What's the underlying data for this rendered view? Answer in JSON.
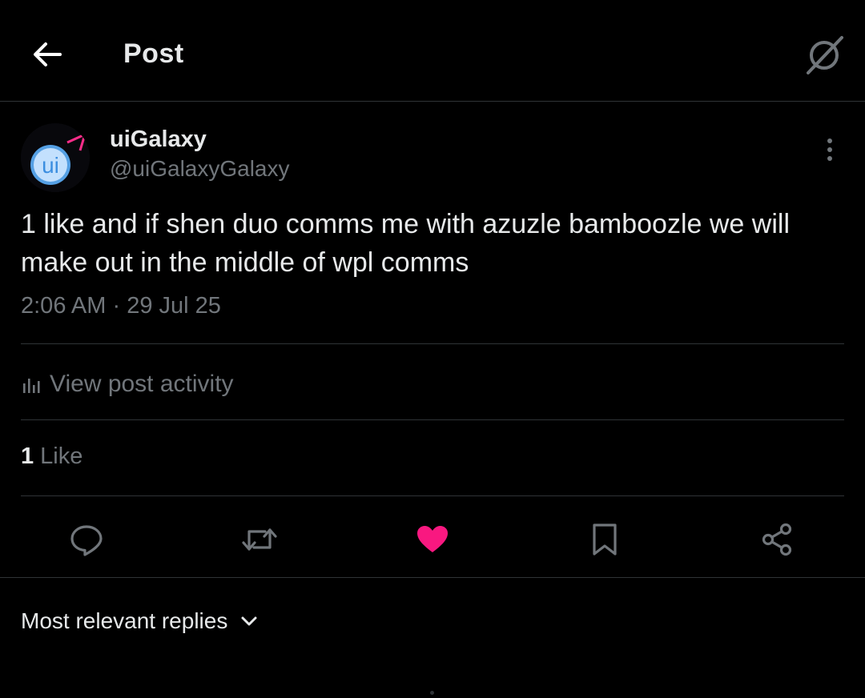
{
  "header": {
    "title": "Post",
    "back_icon": "arrow-left-icon",
    "grok_icon": "grok-icon"
  },
  "author": {
    "name": "uiGalaxy",
    "handle": "@uiGalaxyGalaxy",
    "avatar_text": "ui"
  },
  "post": {
    "text": "1 like and if shen duo comms me with azuzle bamboozle we will make out in the middle of wpl comms",
    "time": "2:06 AM",
    "separator": "·",
    "date": "29 Jul 25"
  },
  "activity": {
    "label": "View post activity",
    "icon": "bar-chart-icon"
  },
  "likes": {
    "count": "1",
    "label": "Like"
  },
  "actions": [
    {
      "name": "reply",
      "icon": "comment-icon"
    },
    {
      "name": "repost",
      "icon": "repost-icon"
    },
    {
      "name": "like",
      "icon": "heart-icon",
      "active": true
    },
    {
      "name": "bookmark",
      "icon": "bookmark-icon"
    },
    {
      "name": "share",
      "icon": "share-icon"
    }
  ],
  "replies": {
    "sort_label": "Most relevant replies"
  },
  "colors": {
    "background": "#000000",
    "text_primary": "#e7e9ea",
    "text_secondary": "#71767b",
    "divider": "#2f3336",
    "like_active": "#f91880",
    "avatar_accent": "#5aa9f0"
  }
}
